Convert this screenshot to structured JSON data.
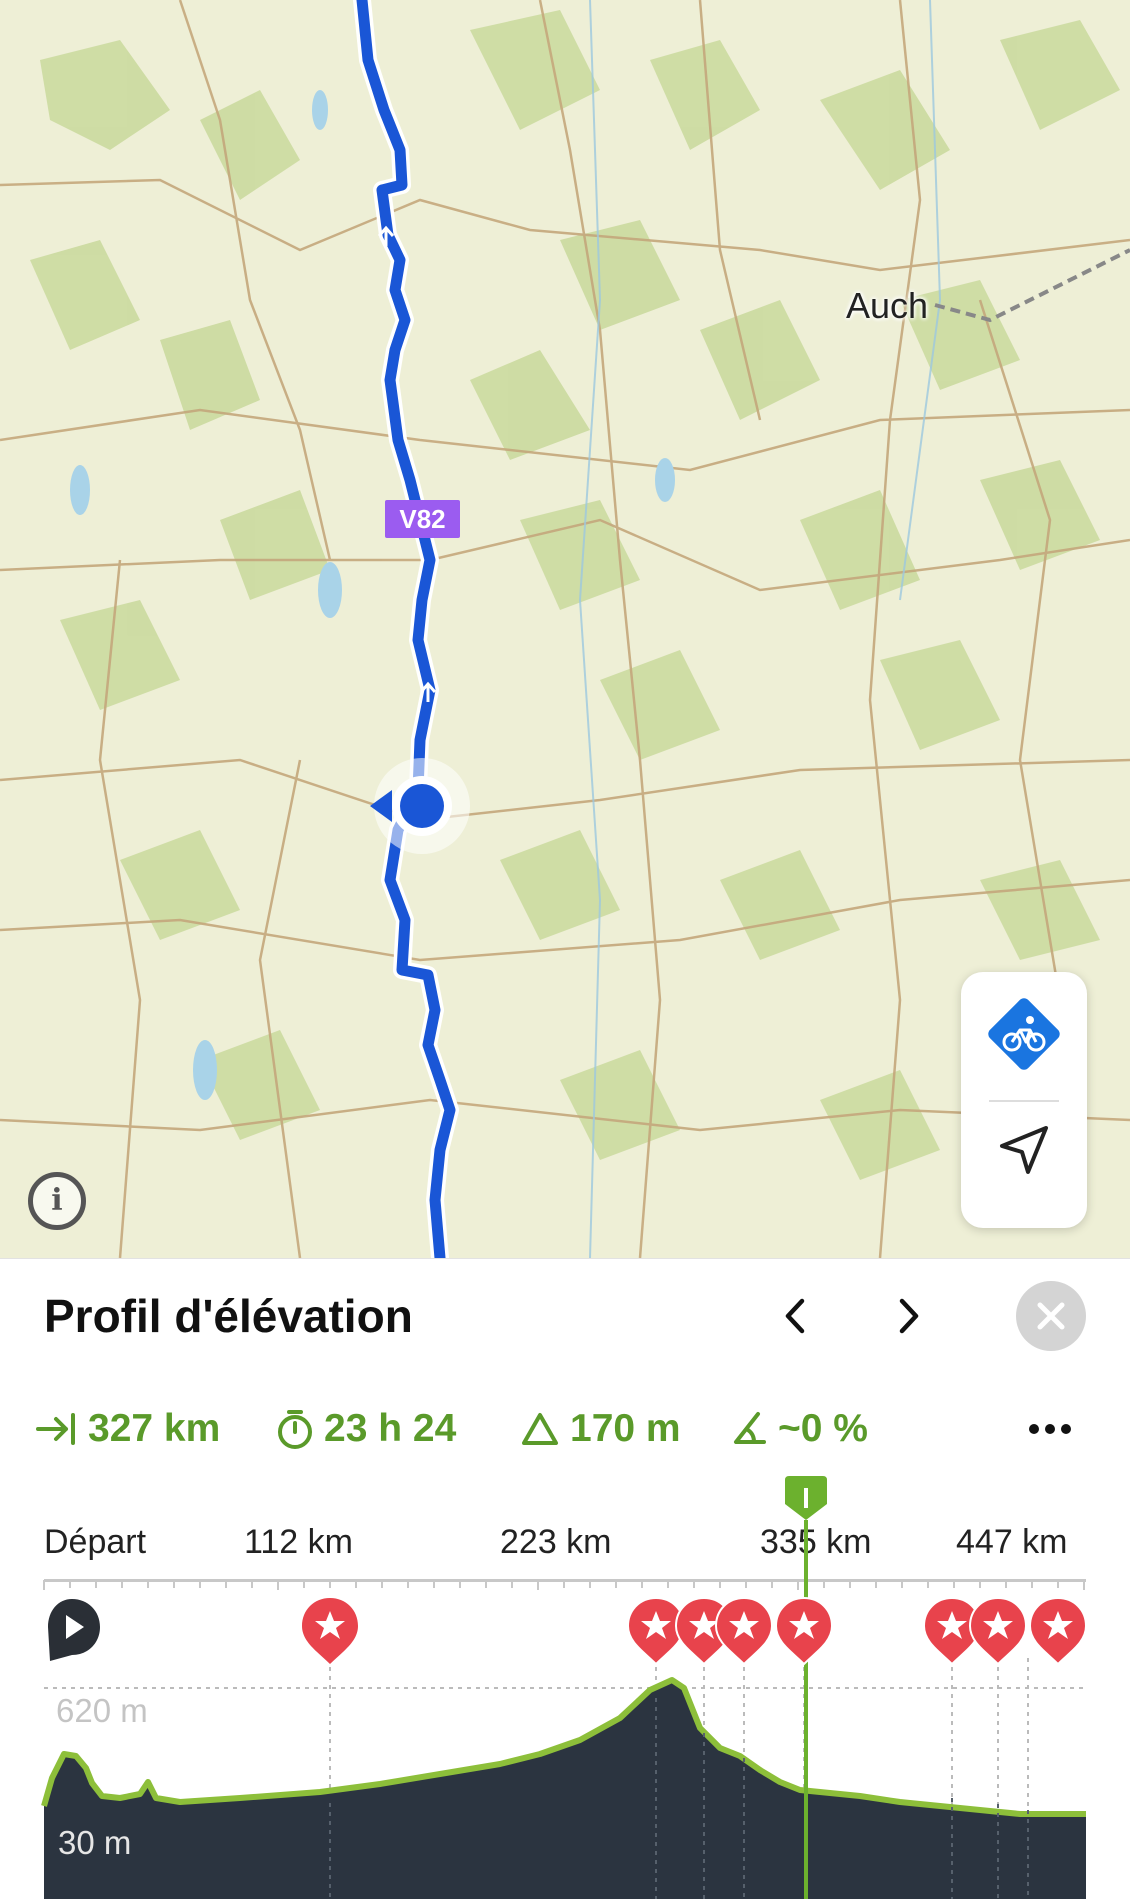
{
  "map": {
    "city_label": "Auch",
    "route_badge": "V82",
    "info_label": "i"
  },
  "controls": {
    "bike_icon": "bike-route-icon",
    "locate_icon": "navigation-arrow-icon"
  },
  "panel": {
    "title": "Profil d'élévation",
    "prev_icon": "chevron-left-icon",
    "next_icon": "chevron-right-icon",
    "close_icon": "close-icon",
    "more_icon": "more-icon"
  },
  "stats": {
    "distance": "327 km",
    "duration": "23 h 24",
    "ascent": "170 m",
    "slope": "~0 %"
  },
  "axis": {
    "labels": [
      "Départ",
      "112 km",
      "223 km",
      "335 km",
      "447 km"
    ]
  },
  "elevation": {
    "max_label": "620 m",
    "min_label": "30 m"
  },
  "colors": {
    "route": "#1a56d6",
    "accent": "#5a9a2a",
    "marker": "#e8434c",
    "profile_fill": "#2b3440"
  }
}
